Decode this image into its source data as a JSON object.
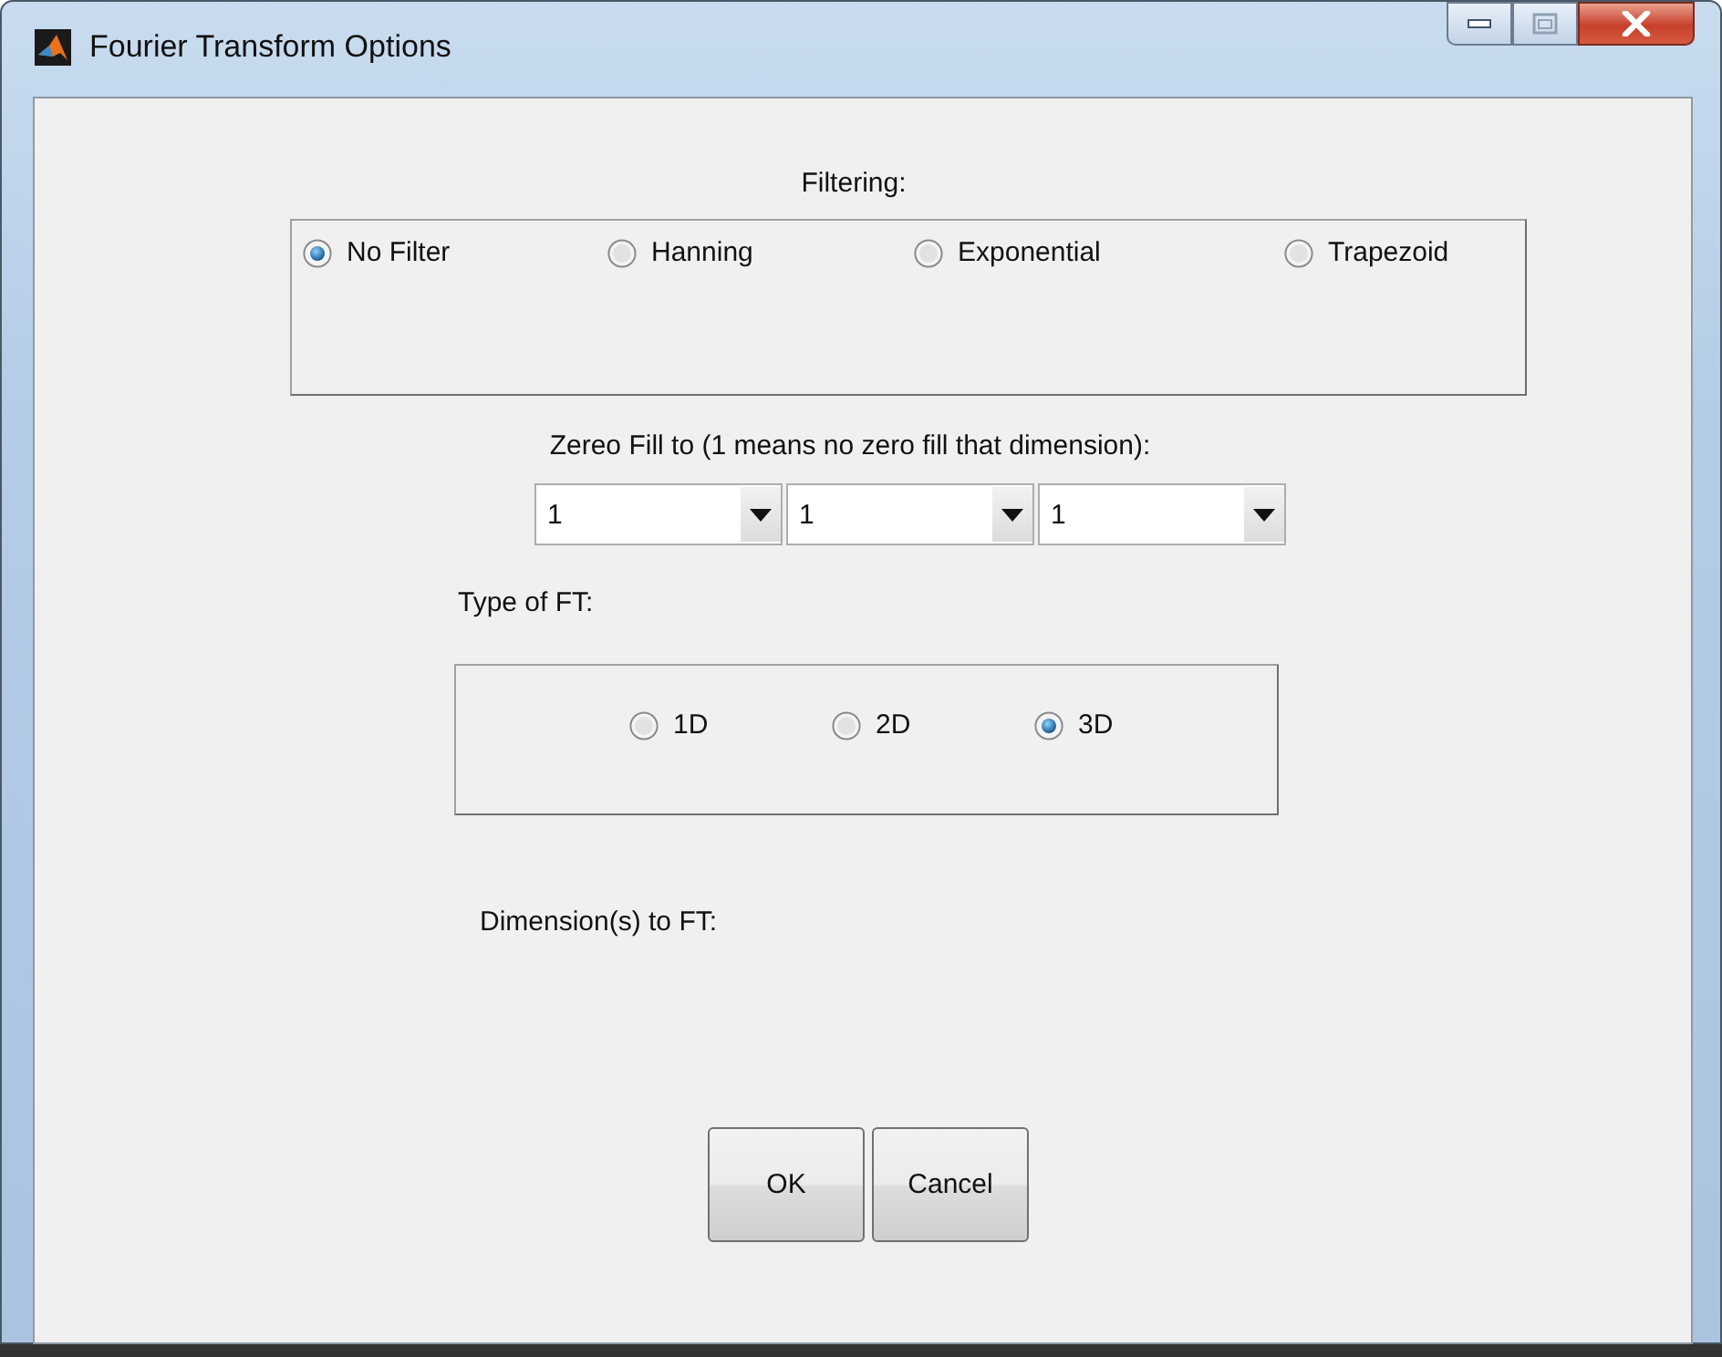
{
  "window": {
    "title": "Fourier Transform Options"
  },
  "filtering": {
    "label": "Filtering:",
    "options": [
      {
        "label": "No Filter",
        "selected": true
      },
      {
        "label": "Hanning",
        "selected": false
      },
      {
        "label": "Exponential",
        "selected": false
      },
      {
        "label": "Trapezoid",
        "selected": false
      }
    ]
  },
  "zero_fill": {
    "label": "Zereo Fill to (1 means no zero fill that dimension):",
    "dropdowns": [
      "1",
      "1",
      "1"
    ]
  },
  "ft_type": {
    "label": "Type of FT:",
    "options": [
      {
        "label": "1D",
        "selected": false
      },
      {
        "label": "2D",
        "selected": false
      },
      {
        "label": "3D",
        "selected": true
      }
    ]
  },
  "dimensions": {
    "label": "Dimension(s) to FT:"
  },
  "buttons": [
    "OK",
    "Cancel"
  ]
}
